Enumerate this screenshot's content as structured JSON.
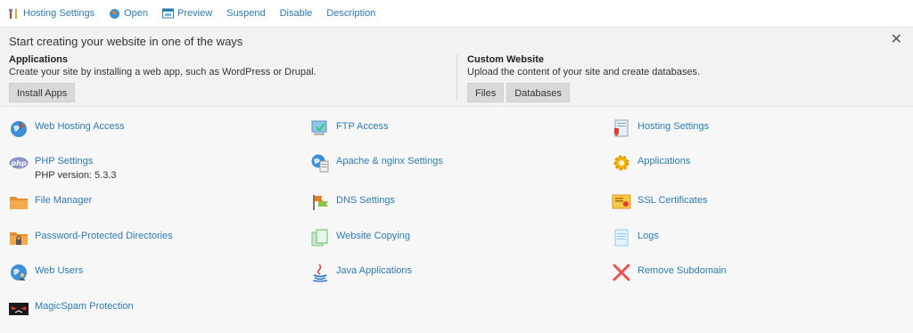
{
  "toolbar": {
    "hosting_settings": "Hosting Settings",
    "open": "Open",
    "preview": "Preview",
    "suspend": "Suspend",
    "disable": "Disable",
    "description": "Description"
  },
  "banner": {
    "title": "Start creating your website in one of the ways",
    "applications": {
      "heading": "Applications",
      "description": "Create your site by installing a web app, such as WordPress or Drupal.",
      "install_button": "Install Apps"
    },
    "custom": {
      "heading": "Custom Website",
      "description": "Upload the content of your site and create databases.",
      "files_button": "Files",
      "databases_button": "Databases"
    }
  },
  "tools": {
    "web_hosting_access": "Web Hosting Access",
    "php_settings": "PHP Settings",
    "php_version": "PHP version: 5.3.3",
    "file_manager": "File Manager",
    "password_protected": "Password-Protected Directories",
    "web_users": "Web Users",
    "magicspam": "MagicSpam Protection",
    "ftp_access": "FTP Access",
    "apache_nginx": "Apache & nginx Settings",
    "dns_settings": "DNS Settings",
    "website_copying": "Website Copying",
    "java_applications": "Java Applications",
    "hosting_settings": "Hosting Settings",
    "applications": "Applications",
    "ssl_certificates": "SSL Certificates",
    "logs": "Logs",
    "remove_subdomain": "Remove Subdomain"
  }
}
